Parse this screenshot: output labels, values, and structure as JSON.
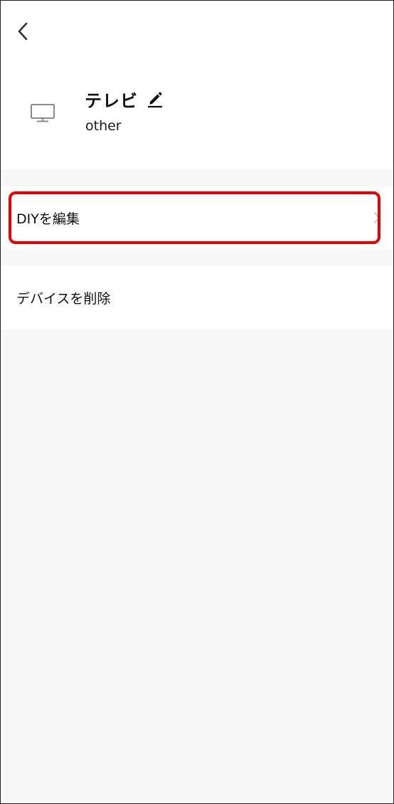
{
  "header": {
    "back_icon": "chevron-left-icon"
  },
  "device": {
    "icon": "monitor-icon",
    "name": "テレビ",
    "edit_icon": "pencil-icon",
    "category": "other"
  },
  "menu": {
    "edit_diy_label": "DIYを編集",
    "edit_diy_icon": "chevron-right-icon",
    "delete_device_label": "デバイスを削除"
  },
  "colors": {
    "background": "#f7f7f7",
    "card": "#ffffff",
    "highlight": "#e60000",
    "icon_gray": "#8a8a8a"
  }
}
